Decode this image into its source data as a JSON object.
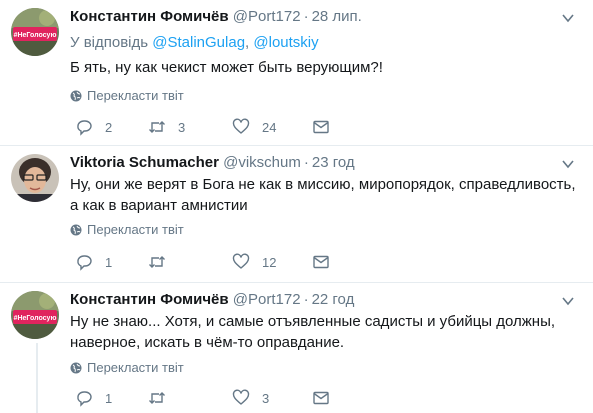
{
  "tweets": [
    {
      "name": "Константин Фомичёв",
      "handle": "@Port172",
      "time": "28 лип.",
      "reply_prefix": "У відповідь",
      "reply_users": [
        "@StalinGulag",
        "@loutskiy"
      ],
      "reply_separator": ",",
      "text": "Б  ять, ну как чекист может быть верующим?!",
      "translate": "Перекласти твіт",
      "replies": "2",
      "retweets": "3",
      "likes": "24",
      "avatar_badge": "#НеГолосую"
    },
    {
      "name": "Viktoria Schumacher",
      "handle": "@vikschum",
      "time": "23 год",
      "text": "Ну, они же верят в Бога не как в миссию, миропорядок, справедливость, а как в вариант амнистии",
      "translate": "Перекласти твіт",
      "replies": "1",
      "retweets": "",
      "likes": "12"
    },
    {
      "name": "Константин Фомичёв",
      "handle": "@Port172",
      "time": "22 год",
      "text": "Ну не знаю... Хотя, и самые отъявленные садисты и убийцы должны, наверное, искать в чём-то оправдание.",
      "translate": "Перекласти твіт",
      "replies": "1",
      "retweets": "",
      "likes": "3",
      "avatar_badge": "#НеГолосую"
    }
  ],
  "colors": {
    "link": "#1da1f2",
    "muted": "#657786",
    "text": "#14171a",
    "badge": "#e0245e"
  },
  "icons": [
    "reply-icon",
    "retweet-icon",
    "like-icon",
    "message-icon",
    "globe-icon",
    "caret-down-icon"
  ]
}
